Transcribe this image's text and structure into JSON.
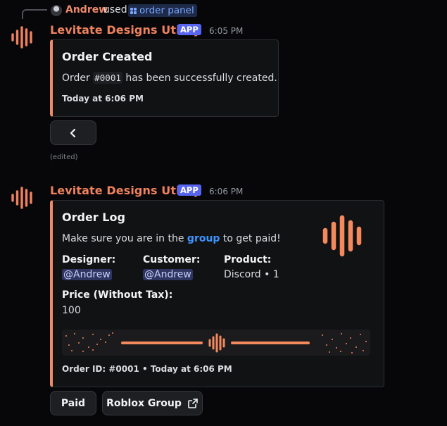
{
  "reply": {
    "user": "Andrew",
    "used_text": "used",
    "command": "order panel"
  },
  "message1": {
    "bot_name": "Levitate Designs Utility",
    "app_tag": "APP",
    "timestamp": "6:05 PM",
    "embed": {
      "title": "Order Created",
      "desc_before": "Order ",
      "order_code": "#0001",
      "desc_after": " has been successfully created.",
      "footer": "Today at 6:06 PM"
    },
    "back_button_icon": "chevron-left-icon",
    "edited": "(edited)"
  },
  "message2": {
    "bot_name": "Levitate Designs Utility",
    "app_tag": "APP",
    "timestamp": "6:06 PM",
    "embed": {
      "title": "Order Log",
      "desc_before": "Make sure you are in the ",
      "desc_link": "group",
      "desc_after": " to get paid!",
      "fields": {
        "designer_label": "Designer:",
        "designer_value": "@Andrew",
        "customer_label": "Customer:",
        "customer_value": "@Andrew",
        "product_label": "Product:",
        "product_value": "Discord • 1",
        "price_label": "Price (Without Tax):",
        "price_value": "100"
      },
      "footer": "Order ID: #0001 • Today at 6:06 PM"
    },
    "buttons": {
      "paid": "Paid",
      "roblox": "Roblox Group",
      "roblox_icon": "external-link-icon"
    }
  },
  "colors": {
    "accent": "#ef8a6a",
    "background": "#070709",
    "embed_bg": "#111214",
    "app_tag": "#5865f2",
    "link": "#3d95ff"
  }
}
